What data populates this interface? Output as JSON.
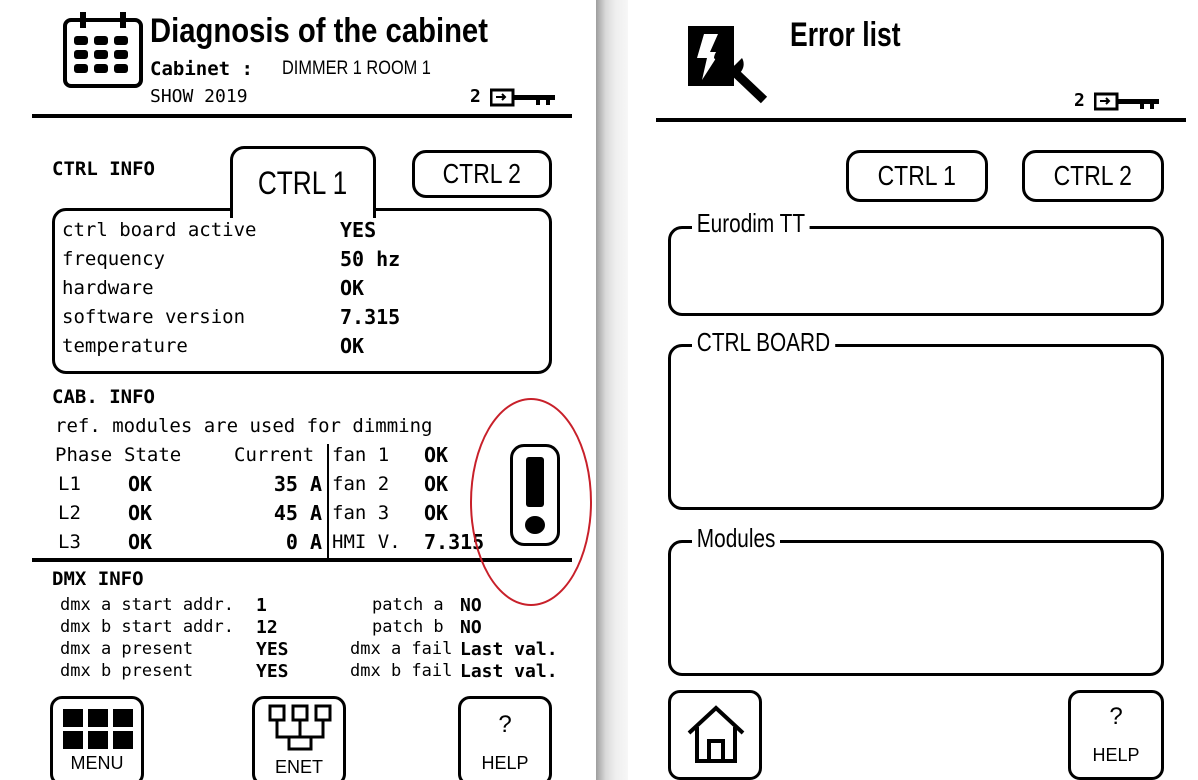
{
  "left": {
    "title": "Diagnosis of the cabinet",
    "cabinet_label": "Cabinet :",
    "cabinet_name": "DIMMER 1 ROOM 1",
    "show": "SHOW 2019",
    "level": "2",
    "ctrl_info_label": "CTRL INFO",
    "tabs": [
      "CTRL 1",
      "CTRL 2"
    ],
    "ctrl_rows": [
      {
        "label": "ctrl board active",
        "value": "YES"
      },
      {
        "label": "frequency",
        "value": "50 hz"
      },
      {
        "label": "hardware",
        "value": "OK"
      },
      {
        "label": "software version",
        "value": "7.315"
      },
      {
        "label": "temperature",
        "value": "OK"
      }
    ],
    "cab_info_label": "CAB. INFO",
    "cab_note": "ref. modules are used for dimming",
    "phase_headers": {
      "phase": "Phase",
      "state": "State",
      "current": "Current"
    },
    "phases": [
      {
        "phase": "L1",
        "state": "OK",
        "current": "35 A"
      },
      {
        "phase": "L2",
        "state": "OK",
        "current": "45 A"
      },
      {
        "phase": "L3",
        "state": "OK",
        "current": "0 A"
      }
    ],
    "fans": [
      {
        "label": "fan 1",
        "value": "OK"
      },
      {
        "label": "fan 2",
        "value": "OK"
      },
      {
        "label": "fan 3",
        "value": "OK"
      },
      {
        "label": "HMI V.",
        "value": "7.315"
      }
    ],
    "dmx_info_label": "DMX INFO",
    "dmx_rows": [
      {
        "label": "dmx a start addr.",
        "value": "1",
        "label2": "patch a",
        "value2": "NO"
      },
      {
        "label": "dmx b start addr.",
        "value": "12",
        "label2": "patch b",
        "value2": "NO"
      },
      {
        "label": "dmx a present",
        "value": "YES",
        "label2": "dmx a fail",
        "value2": "Last val."
      },
      {
        "label": "dmx b present",
        "value": "YES",
        "label2": "dmx b fail",
        "value2": "Last val."
      }
    ],
    "buttons": {
      "menu": "MENU",
      "enet": "ENET",
      "help_glyph": "?",
      "help": "HELP"
    }
  },
  "right": {
    "title": "Error list",
    "level": "2",
    "tabs": [
      "CTRL 1",
      "CTRL 2"
    ],
    "sections": [
      "Eurodim TT",
      "CTRL BOARD",
      "Modules"
    ],
    "buttons": {
      "help_glyph": "?",
      "help": "HELP"
    }
  },
  "colors": {
    "annotation": "#c8202a",
    "ink": "#000000",
    "background": "#ffffff"
  }
}
